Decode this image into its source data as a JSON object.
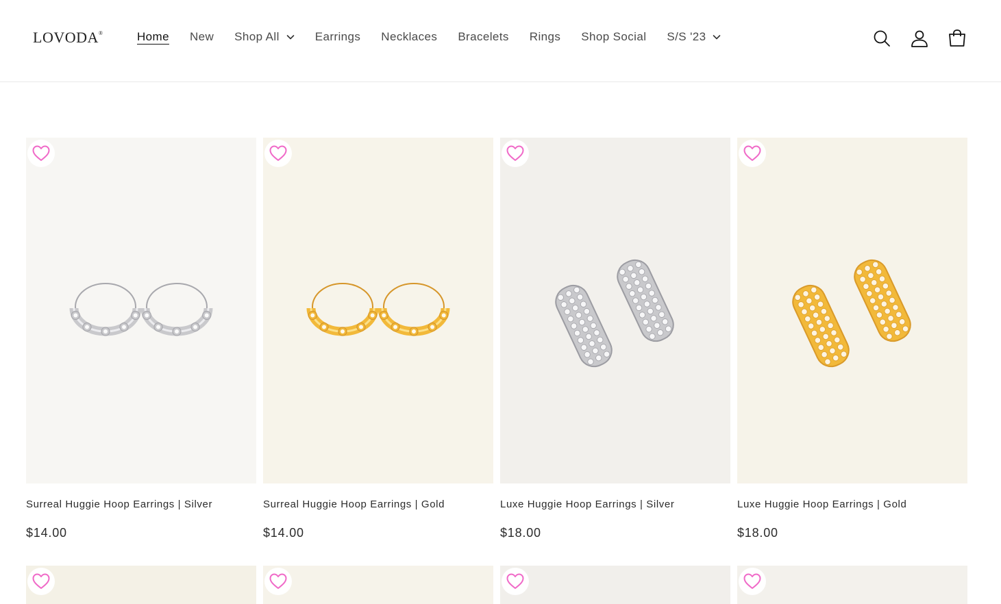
{
  "brand": {
    "logo_text": "LOVODA",
    "logo_mark": "®"
  },
  "nav": {
    "items": [
      {
        "label": "Home",
        "active": true,
        "has_dropdown": false
      },
      {
        "label": "New",
        "active": false,
        "has_dropdown": false
      },
      {
        "label": "Shop All",
        "active": false,
        "has_dropdown": true
      },
      {
        "label": "Earrings",
        "active": false,
        "has_dropdown": false
      },
      {
        "label": "Necklaces",
        "active": false,
        "has_dropdown": false
      },
      {
        "label": "Bracelets",
        "active": false,
        "has_dropdown": false
      },
      {
        "label": "Rings",
        "active": false,
        "has_dropdown": false
      },
      {
        "label": "Shop Social",
        "active": false,
        "has_dropdown": false
      },
      {
        "label": "S/S '23",
        "active": false,
        "has_dropdown": true
      }
    ]
  },
  "header_icons": [
    "search-icon",
    "account-icon",
    "cart-icon"
  ],
  "products": [
    {
      "title": "Surreal Huggie Hoop Earrings | Silver",
      "price": "$14.00",
      "metal": "silver",
      "style": "surreal",
      "bg": "#f7f6f3"
    },
    {
      "title": "Surreal Huggie Hoop Earrings | Gold",
      "price": "$14.00",
      "metal": "gold",
      "style": "surreal",
      "bg": "#f7f4ea"
    },
    {
      "title": "Luxe Huggie Hoop Earrings | Silver",
      "price": "$18.00",
      "metal": "silver",
      "style": "luxe",
      "bg": "#f2f0ec"
    },
    {
      "title": "Luxe Huggie Hoop Earrings | Gold",
      "price": "$18.00",
      "metal": "gold",
      "style": "luxe",
      "bg": "#f6f3e9"
    }
  ],
  "second_row_bgs": [
    "#f4f1e6",
    "#f6f3ea",
    "#f1efeb",
    "#f3f1ec"
  ],
  "colors": {
    "heart": "#f06ac8",
    "silver": "#c9c9cc",
    "gold": "#f2b93a",
    "text": "#2b2b2b"
  }
}
